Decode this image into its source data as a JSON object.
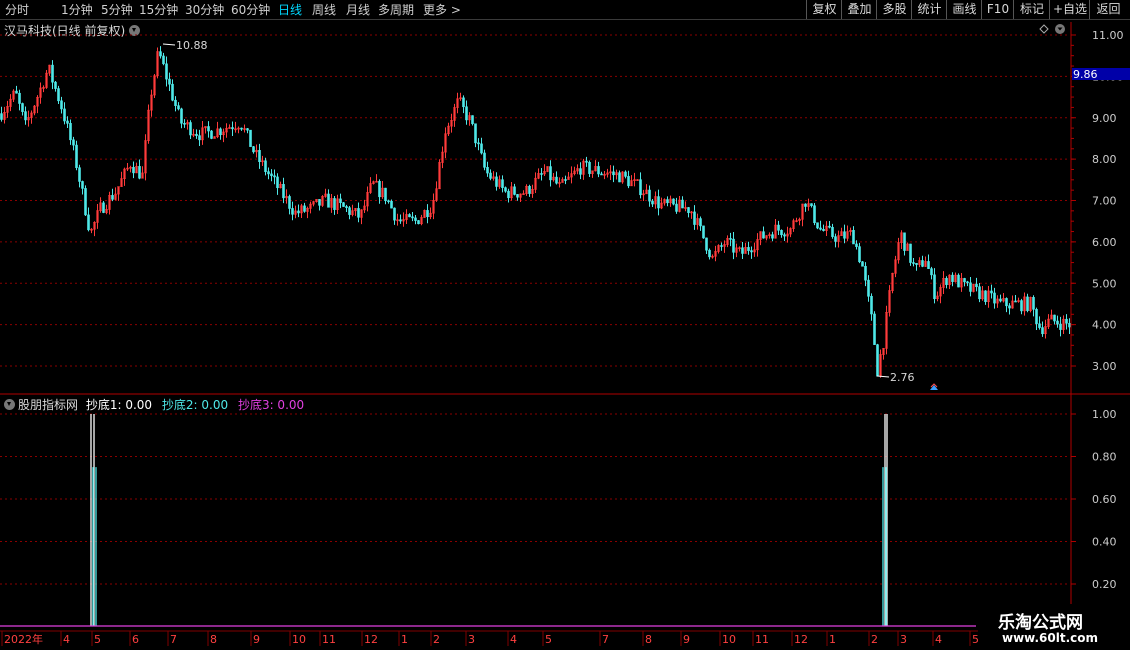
{
  "toolbar": {
    "periods": [
      "分时",
      "1分钟",
      "5分钟",
      "15分钟",
      "30分钟",
      "60分钟",
      "日线",
      "周线",
      "月线",
      "多周期",
      "更多 >"
    ],
    "active_period": "日线",
    "right_buttons": [
      "复权",
      "叠加",
      "多股",
      "统计",
      "画线",
      "F10",
      "标记",
      "+自选",
      "返回"
    ]
  },
  "main_chart": {
    "title": "汉马科技(日线 前复权)",
    "high_label": "10.88",
    "low_label": "2.76",
    "current_price": "9.86",
    "y_ticks": [
      "11.00",
      "10.00",
      "9.00",
      "8.00",
      "7.00",
      "6.00",
      "5.00",
      "4.00",
      "3.00"
    ],
    "colors": {
      "up": "#ff3b3b",
      "down": "#4fe8e8",
      "grid": "#8a0000",
      "axis": "#b00000",
      "price_box": "#0000a8"
    }
  },
  "indicator": {
    "source": "股朋指标网",
    "line1_label": "抄底1: 0.00",
    "line2_label": "抄底2: 0.00",
    "line3_label": "抄底3: 0.00",
    "colors": {
      "line1": "#ffffff",
      "line2": "#4fe8e8",
      "line3": "#e040e0"
    },
    "y_ticks": [
      "1.00",
      "0.80",
      "0.60",
      "0.40",
      "0.20"
    ]
  },
  "x_axis": {
    "labels": [
      "2022年",
      "4",
      "5",
      "6",
      "7",
      "8",
      "9",
      "10",
      "11",
      "12",
      "1",
      "2",
      "3",
      "4",
      "5",
      "7",
      "8",
      "9",
      "10",
      "11",
      "12",
      "1",
      "2",
      "3",
      "4",
      "5"
    ]
  },
  "watermark": {
    "line1": "乐淘公式网",
    "line2": "www.60lt.com"
  },
  "chart_data": {
    "type": "candlestick",
    "title": "汉马科技(日线 前复权)",
    "ylim": [
      2.5,
      11.3
    ],
    "annotations": [
      {
        "label": "10.88",
        "value": 10.88
      },
      {
        "label": "2.76",
        "value": 2.76
      }
    ],
    "price_path": [
      [
        0,
        9.1
      ],
      [
        15,
        9.6
      ],
      [
        25,
        8.8
      ],
      [
        40,
        9.7
      ],
      [
        48,
        10.2
      ],
      [
        62,
        9.2
      ],
      [
        75,
        8.0
      ],
      [
        90,
        6.2
      ],
      [
        100,
        6.8
      ],
      [
        115,
        7.2
      ],
      [
        130,
        7.9
      ],
      [
        142,
        7.6
      ],
      [
        150,
        9.5
      ],
      [
        158,
        10.6
      ],
      [
        166,
        10.0
      ],
      [
        180,
        8.9
      ],
      [
        200,
        8.6
      ],
      [
        218,
        8.7
      ],
      [
        240,
        8.9
      ],
      [
        255,
        8.1
      ],
      [
        275,
        7.4
      ],
      [
        295,
        6.7
      ],
      [
        310,
        6.8
      ],
      [
        325,
        7.0
      ],
      [
        345,
        6.8
      ],
      [
        360,
        6.6
      ],
      [
        372,
        7.4
      ],
      [
        385,
        7.1
      ],
      [
        398,
        6.5
      ],
      [
        415,
        6.5
      ],
      [
        432,
        6.9
      ],
      [
        445,
        8.7
      ],
      [
        458,
        9.4
      ],
      [
        470,
        8.9
      ],
      [
        485,
        7.7
      ],
      [
        505,
        7.2
      ],
      [
        525,
        7.2
      ],
      [
        545,
        7.7
      ],
      [
        560,
        7.3
      ],
      [
        580,
        7.8
      ],
      [
        600,
        7.7
      ],
      [
        620,
        7.6
      ],
      [
        640,
        7.3
      ],
      [
        660,
        6.9
      ],
      [
        690,
        6.8
      ],
      [
        705,
        6.0
      ],
      [
        712,
        5.6
      ],
      [
        725,
        6.0
      ],
      [
        740,
        5.7
      ],
      [
        760,
        6.1
      ],
      [
        775,
        6.3
      ],
      [
        790,
        6.3
      ],
      [
        805,
        7.0
      ],
      [
        820,
        6.3
      ],
      [
        838,
        6.1
      ],
      [
        852,
        6.2
      ],
      [
        862,
        5.4
      ],
      [
        872,
        4.0
      ],
      [
        877,
        2.9
      ],
      [
        883,
        3.6
      ],
      [
        892,
        5.2
      ],
      [
        900,
        6.2
      ],
      [
        915,
        5.3
      ],
      [
        925,
        5.6
      ],
      [
        935,
        4.7
      ],
      [
        948,
        5.2
      ],
      [
        965,
        4.9
      ],
      [
        985,
        4.7
      ],
      [
        1000,
        4.5
      ],
      [
        1015,
        4.5
      ],
      [
        1030,
        4.5
      ],
      [
        1040,
        3.9
      ],
      [
        1050,
        4.1
      ],
      [
        1070,
        4.0
      ]
    ],
    "indicator_series": [
      {
        "name": "抄底1",
        "signal_x": [
          91,
          94,
          885,
          887
        ],
        "value": 1.0
      },
      {
        "name": "抄底2",
        "signal_x": [
          93,
          96,
          883,
          886
        ],
        "value": 0.75
      }
    ]
  }
}
